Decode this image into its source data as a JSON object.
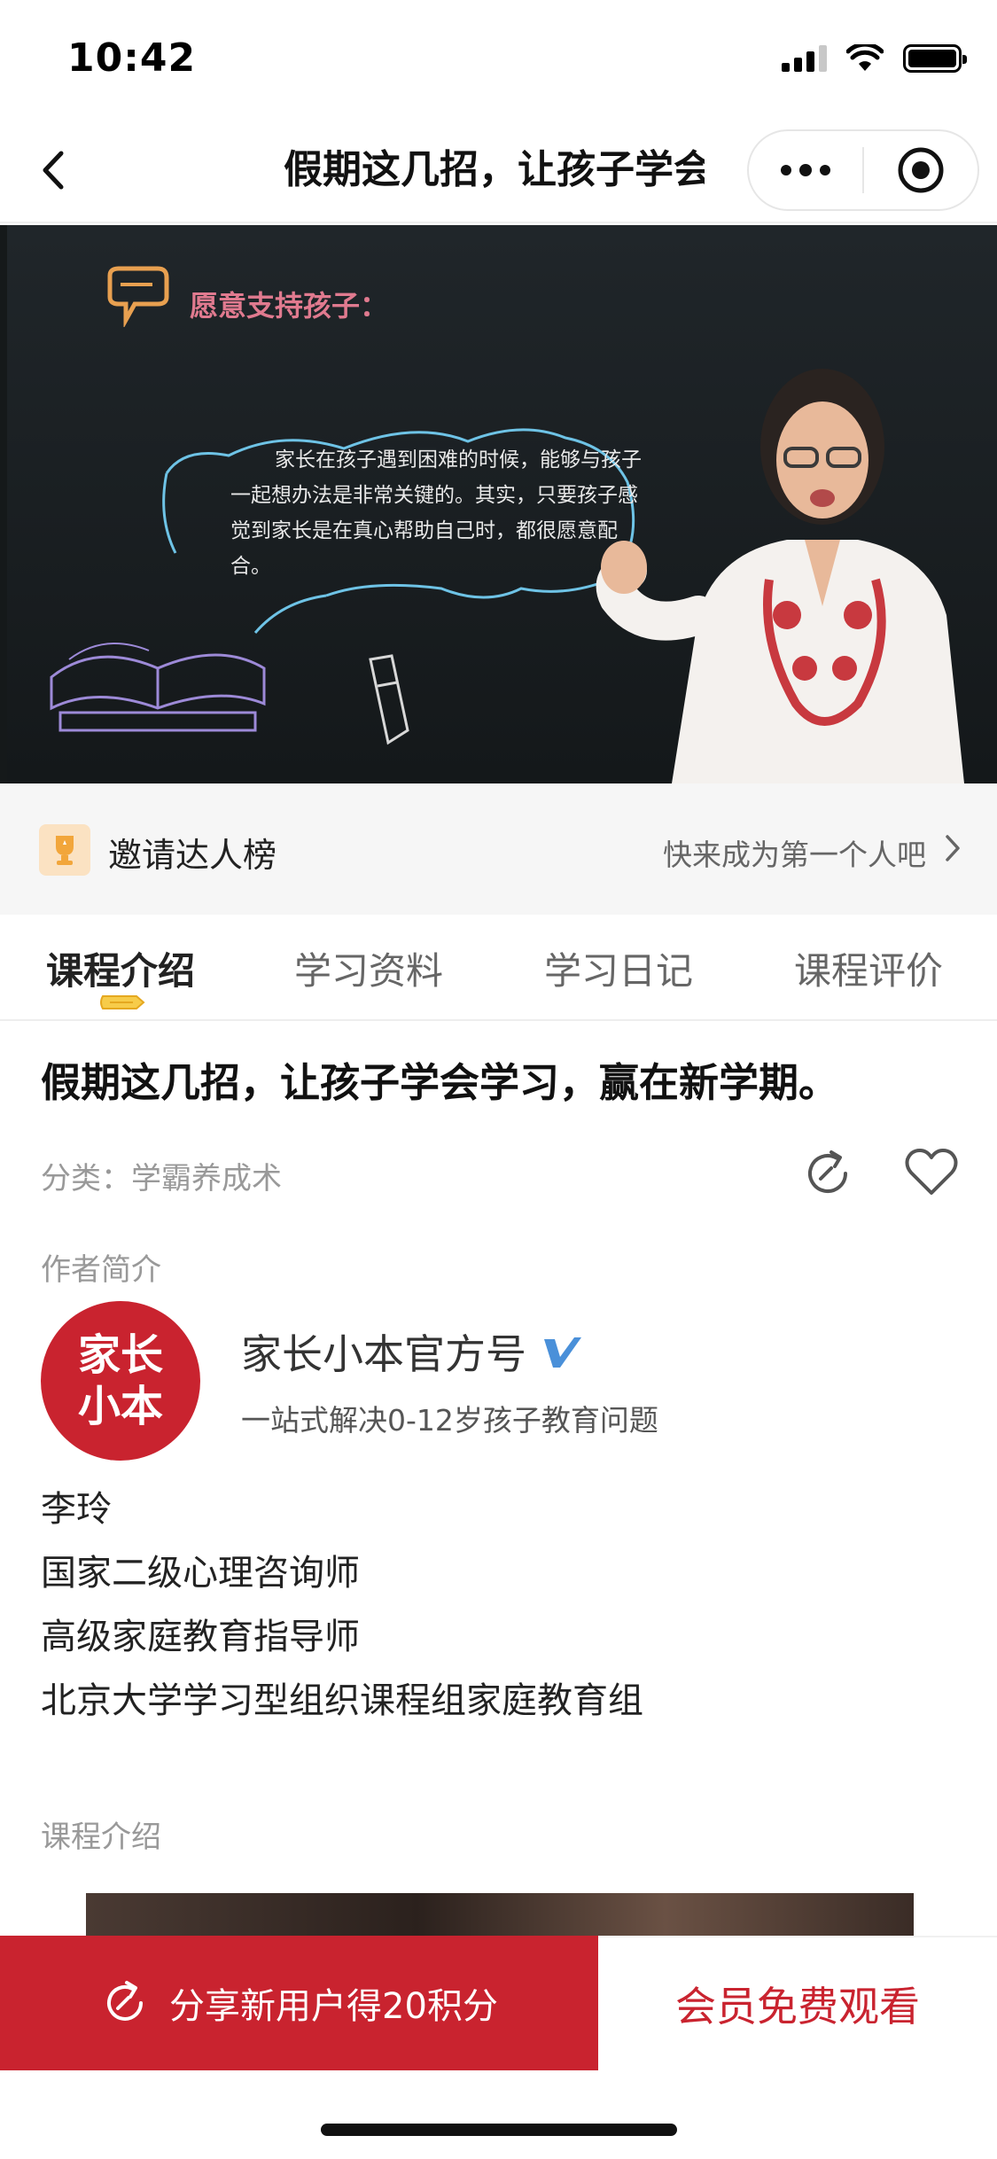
{
  "status_bar": {
    "time": "10:42"
  },
  "nav": {
    "title": "假期这几招，让孩子学会学习，赢在新学期。",
    "back_icon": "chevron-left-icon",
    "more_icon": "more-dots-icon",
    "close_icon": "target-circle-icon"
  },
  "video": {
    "board_heading": "愿意支持孩子：",
    "board_text": "家长在孩子遇到困难的时候，能够与孩子一起想办法是非常关键的。其实，只要孩子感觉到家长是在真心帮助自己时，都很愿意配合。"
  },
  "invite": {
    "title": "邀请达人榜",
    "link": "快来成为第一个人吧",
    "badge_icon": "trophy-icon"
  },
  "tabs": [
    {
      "label": "课程介绍",
      "active": true
    },
    {
      "label": "学习资料",
      "active": false
    },
    {
      "label": "学习日记",
      "active": false
    },
    {
      "label": "课程评价",
      "active": false
    }
  ],
  "course": {
    "title": "假期这几招，让孩子学会学习，赢在新学期。",
    "category_label": "分类：",
    "category_value": "学霸养成术"
  },
  "author": {
    "section_label": "作者简介",
    "avatar_text_line1": "家长",
    "avatar_text_line2": "小本",
    "name": "家长小本官方号",
    "description": "一站式解决0-12岁孩子教育问题",
    "verified_icon": "verified-v-icon",
    "bio": [
      "李玲",
      "国家二级心理咨询师",
      "高级家庭教育指导师",
      "北京大学学习型组织课程组家庭教育组"
    ]
  },
  "intro": {
    "section_label": "课程介绍"
  },
  "bottom": {
    "share_label": "分享新用户得20积分",
    "vip_label": "会员免费观看"
  },
  "colors": {
    "brand_red": "#c9232f",
    "accent_orange": "#f2a63b"
  }
}
